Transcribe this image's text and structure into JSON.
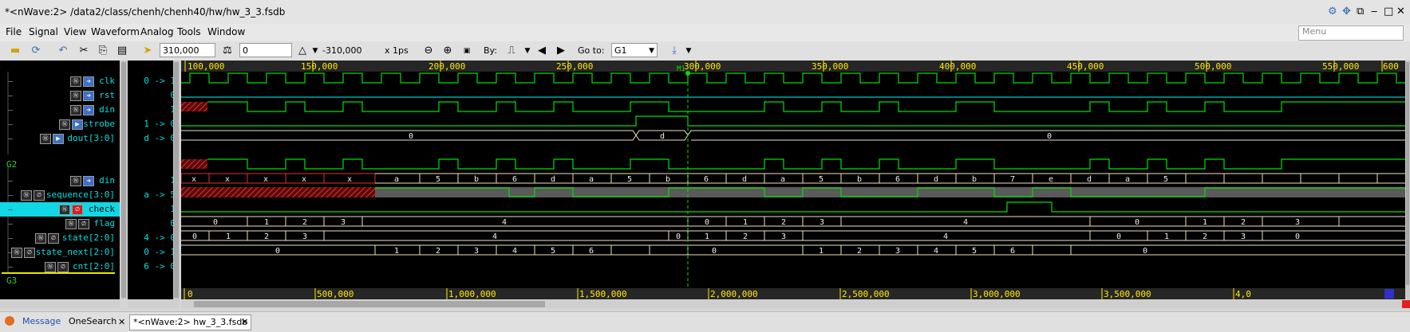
{
  "window": {
    "title": "*<nWave:2> /data2/class/chenh/chenh40/hw/hw_3_3.fsdb"
  },
  "menu": {
    "items": [
      "File",
      "Signal",
      "View",
      "Waveform",
      "Analog",
      "Tools",
      "Window"
    ],
    "search_placeholder": "Menu"
  },
  "toolbar": {
    "cursor_time": "310,000",
    "marker_time": "0",
    "delta": "-310,000",
    "unit": "x 1ps",
    "by_label": "By:",
    "goto_label": "Go to:",
    "goto_value": "G1"
  },
  "groups": {
    "g2": "G2",
    "g3": "G3"
  },
  "signals": [
    {
      "name": "clk",
      "value": "0 -> 1"
    },
    {
      "name": "rst",
      "value": "0"
    },
    {
      "name": "din",
      "value": "1"
    },
    {
      "name": "strobe",
      "value": "1 -> 0"
    },
    {
      "name": "dout[3:0]",
      "value": "d -> 0"
    },
    {
      "name": "din",
      "value": "1"
    },
    {
      "name": "sequence[3:0]",
      "value": "a -> 5"
    },
    {
      "name": "check",
      "value": "1"
    },
    {
      "name": "flag",
      "value": "0"
    },
    {
      "name": "state[2:0]",
      "value": "4 -> 0"
    },
    {
      "name": "state_next[2:0]",
      "value": "0 -> 1"
    },
    {
      "name": "cnt[2:0]",
      "value": "6 -> 0"
    }
  ],
  "ruler": {
    "top_labels": [
      "100,000",
      "150,000",
      "200,000",
      "250,000",
      "300,000",
      "350,000",
      "400,000",
      "450,000",
      "500,000",
      "550,000",
      "600"
    ],
    "bottom_labels": [
      "0",
      "500,000",
      "1,000,000",
      "1,500,000",
      "2,000,000",
      "2,500,000",
      "3,000,000",
      "3,500,000",
      "4,0"
    ],
    "marker_label": "M1"
  },
  "waves": {
    "dout_labels": [
      "0",
      "d",
      "0"
    ],
    "sequence_labels": [
      "x",
      "x",
      "x",
      "x",
      "x",
      "a",
      "5",
      "b",
      "6",
      "d",
      "a",
      "5",
      "b",
      "6",
      "d",
      "a",
      "5",
      "b",
      "6",
      "d",
      "b",
      "7",
      "e",
      "d",
      "a",
      "5"
    ],
    "state_labels": [
      "0",
      "1",
      "2",
      "3",
      "4",
      "0",
      "1",
      "2",
      "3",
      "4",
      "0",
      "1",
      "2",
      "3"
    ],
    "state_next_labels": [
      "0",
      "1",
      "2",
      "3",
      "4",
      "0",
      "1",
      "2",
      "3",
      "4",
      "0",
      "1",
      "2",
      "3",
      "0"
    ],
    "cnt_labels": [
      "0",
      "1",
      "2",
      "3",
      "4",
      "5",
      "6",
      "0",
      "1",
      "2",
      "3",
      "4",
      "5",
      "6",
      "0"
    ]
  },
  "tabs": {
    "message": "Message",
    "onesearch": "OneSearch",
    "nwave": "*<nWave:2> hw_3_3.fsdb"
  },
  "colors": {
    "wave_green": "#00e000",
    "wave_cyan": "#00c8c8",
    "ruler_yellow": "#ffea00",
    "selection": "#10d8e4"
  }
}
